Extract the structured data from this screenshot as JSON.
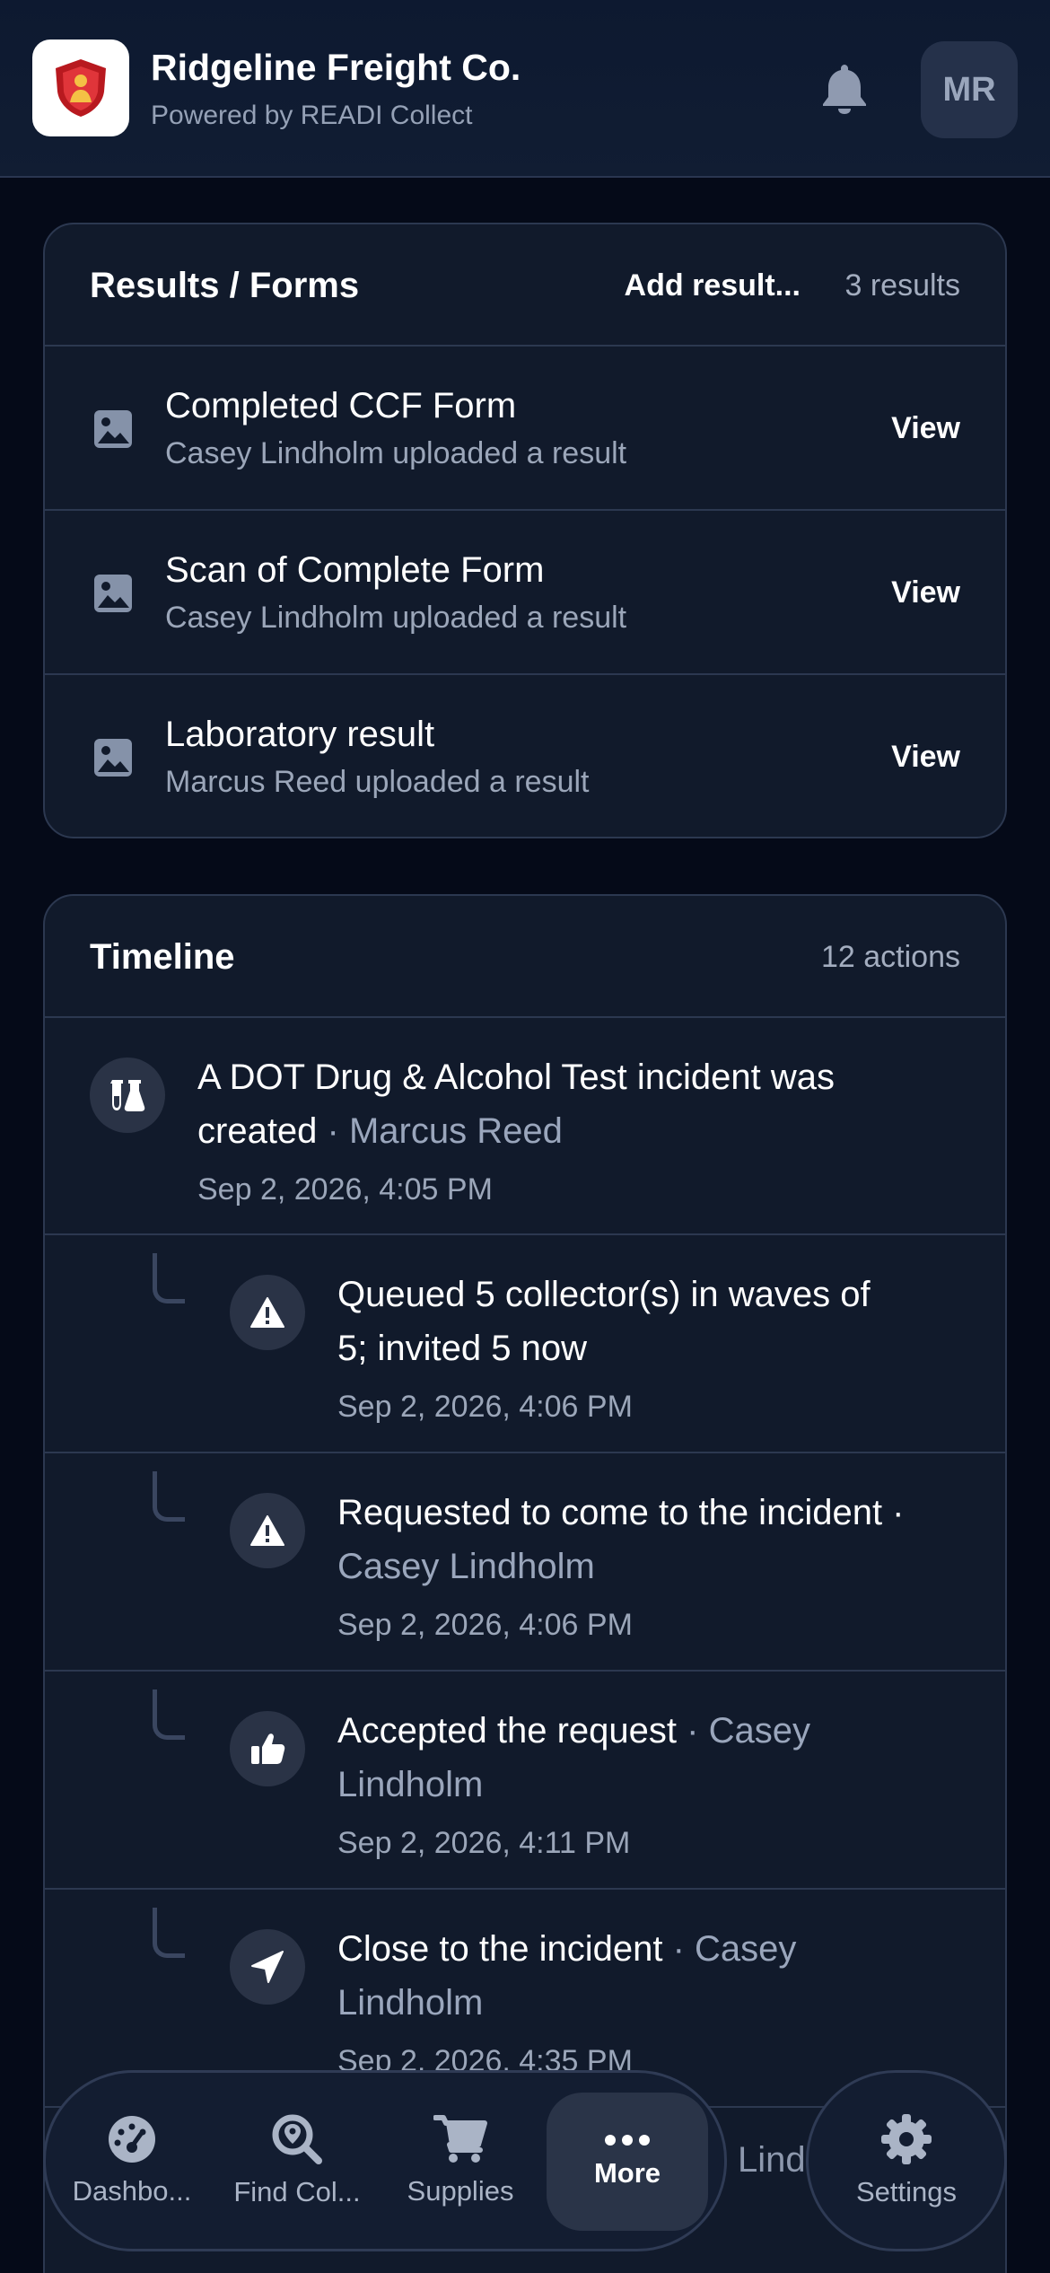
{
  "header": {
    "org_name": "Ridgeline Freight Co.",
    "powered_by": "Powered by READI Collect",
    "avatar_initials": "MR"
  },
  "results": {
    "title": "Results / Forms",
    "add_label": "Add result...",
    "count": "3 results",
    "items": [
      {
        "title": "Completed CCF Form",
        "subtitle": "Casey Lindholm uploaded a result",
        "action": "View"
      },
      {
        "title": "Scan of Complete Form",
        "subtitle": "Casey Lindholm uploaded a result",
        "action": "View"
      },
      {
        "title": "Laboratory result",
        "subtitle": "Marcus Reed uploaded a result",
        "action": "View"
      }
    ]
  },
  "timeline": {
    "title": "Timeline",
    "count": "12 actions",
    "items": [
      {
        "icon": "flask-icon",
        "line1": "A DOT Drug & Alcohol Test incident was",
        "line2": "created",
        "by": " · Marcus Reed",
        "time": "Sep 2, 2026, 4:05 PM"
      },
      {
        "icon": "warning-icon",
        "line1": "Queued 5 collector(s) in waves of",
        "line2": "5; invited 5 now",
        "by": "",
        "time": "Sep 2, 2026, 4:06 PM"
      },
      {
        "icon": "warning-icon",
        "line1": "Requested to come to the incident ·",
        "line2": "",
        "by": "Casey Lindholm",
        "time": "Sep 2, 2026, 4:06 PM"
      },
      {
        "icon": "thumbs-up-icon",
        "line1": "Accepted the request",
        "line1_by": " · Casey",
        "line2": "",
        "by": "Lindholm",
        "time": "Sep 2, 2026, 4:11 PM"
      },
      {
        "icon": "location-arrow-icon",
        "line1": "Close to the incident",
        "line1_by": " · Casey",
        "line2": "",
        "by": "Lindholm",
        "time": "Sep 2, 2026, 4:35 PM"
      }
    ],
    "peek_text": "Lind"
  },
  "nav": {
    "items": [
      {
        "icon": "gauge-icon",
        "label": "Dashbo..."
      },
      {
        "icon": "search-location-icon",
        "label": "Find Col..."
      },
      {
        "icon": "cart-icon",
        "label": "Supplies"
      },
      {
        "icon": "more-icon",
        "label": "More"
      }
    ],
    "settings_label": "Settings"
  }
}
